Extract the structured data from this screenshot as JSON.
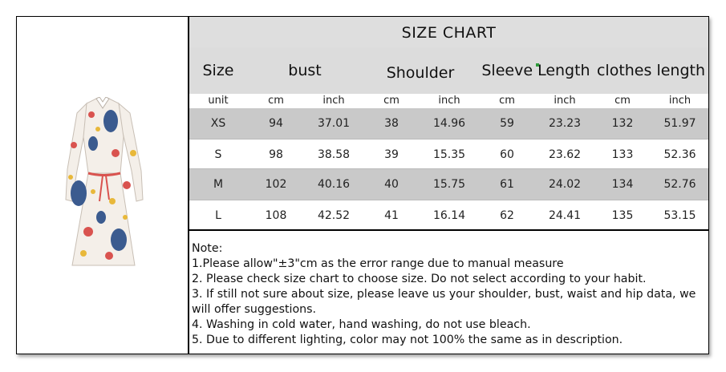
{
  "title": "SIZE CHART",
  "headers": {
    "size": "Size",
    "bust": "bust",
    "shoulder": "Shoulder",
    "sleeve": "Sleeve Length",
    "clothes": "clothes length"
  },
  "units": [
    "unit",
    "cm",
    "inch",
    "cm",
    "inch",
    "cm",
    "inch",
    "cm",
    "inch"
  ],
  "rows": [
    [
      "XS",
      "94",
      "37.01",
      "38",
      "14.96",
      "59",
      "23.23",
      "132",
      "51.97"
    ],
    [
      "S",
      "98",
      "38.58",
      "39",
      "15.35",
      "60",
      "23.62",
      "133",
      "52.36"
    ],
    [
      "M",
      "102",
      "40.16",
      "40",
      "15.75",
      "61",
      "24.02",
      "134",
      "52.76"
    ],
    [
      "L",
      "108",
      "42.52",
      "41",
      "16.14",
      "62",
      "24.41",
      "135",
      "53.15"
    ]
  ],
  "notes": {
    "heading": " Note:",
    "items": [
      "1.Please allow\"±3\"cm as the error range due to manual measure",
      "2. Please check size chart to choose size. Do not select according to your habit.",
      "3. If still not sure about size, please leave us your shoulder, bust, waist and hip data, we will offer suggestions.",
      "4. Washing in cold water, hand washing, do not use bleach.",
      "5. Due to different lighting, color may not 100% the same as in description."
    ]
  },
  "colors": {
    "header_bg": "#dcdcdc",
    "row_gray": "#c9c9c9",
    "dress_base": "#f4efe9",
    "print_blue": "#3b5b8f",
    "print_red": "#d9534f",
    "print_yellow": "#e8b83a"
  }
}
